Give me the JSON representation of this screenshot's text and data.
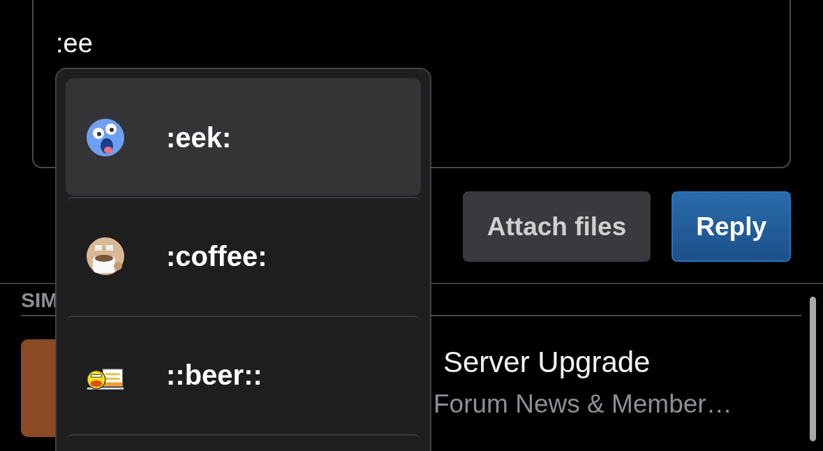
{
  "editor": {
    "value": ":ee"
  },
  "buttons": [
    {
      "label": "Attach files",
      "kind": "secondary"
    },
    {
      "label": "Reply",
      "kind": "primary"
    }
  ],
  "similar": {
    "heading": "SIM",
    "threads": [
      {
        "title": "Server Upgrade",
        "forum": "Forum News & Member…"
      }
    ]
  },
  "suggestions": [
    {
      "label": ":eek:",
      "selected": true
    },
    {
      "label": ":coffee:",
      "selected": false
    },
    {
      "label": "::beer::",
      "selected": false
    }
  ]
}
